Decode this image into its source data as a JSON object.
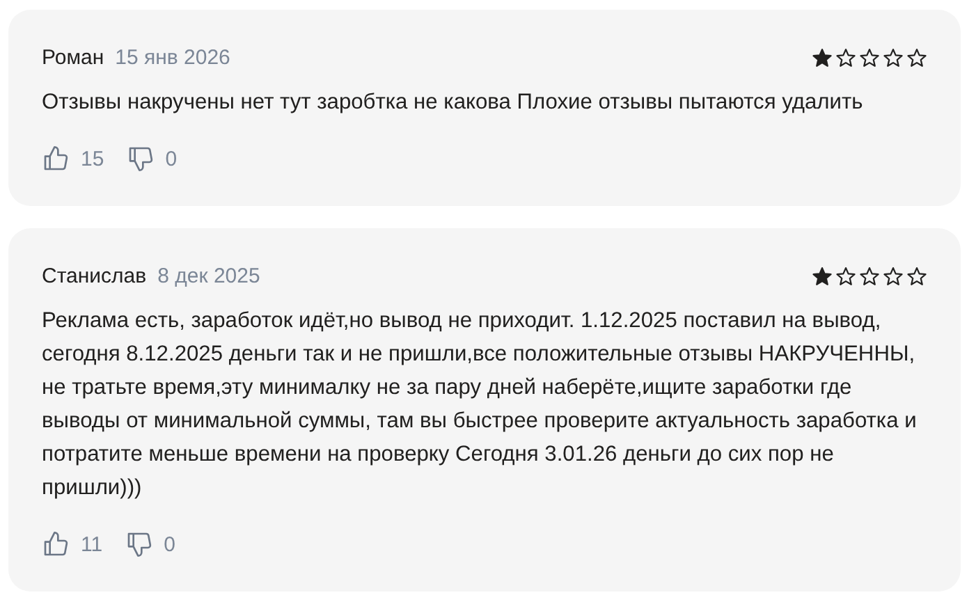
{
  "reviews": [
    {
      "author": "Роман",
      "date": "15 янв 2026",
      "stars": 1,
      "text": "Отзывы накручены нет тут заробтка не какова Плохие отзывы пытаются удалить",
      "likes": "15",
      "dislikes": "0"
    },
    {
      "author": "Станислав",
      "date": "8 дек 2025",
      "stars": 1,
      "text": "Реклама есть, заработок идёт,но вывод не приходит. 1.12.2025 поставил на вывод, сегодня 8.12.2025 деньги так и не пришли,все положительные отзывы НАКРУЧЕННЫ, не тратьте время,эту минималку не за пару дней наберёте,ищите заработки где выводы от минимальной суммы, там вы быстрее проверите актуальность заработка и потратите меньше времени на проверку Сегодня 3.01.26 деньги до сих пор не пришли)))",
      "likes": "11",
      "dislikes": "0"
    }
  ]
}
